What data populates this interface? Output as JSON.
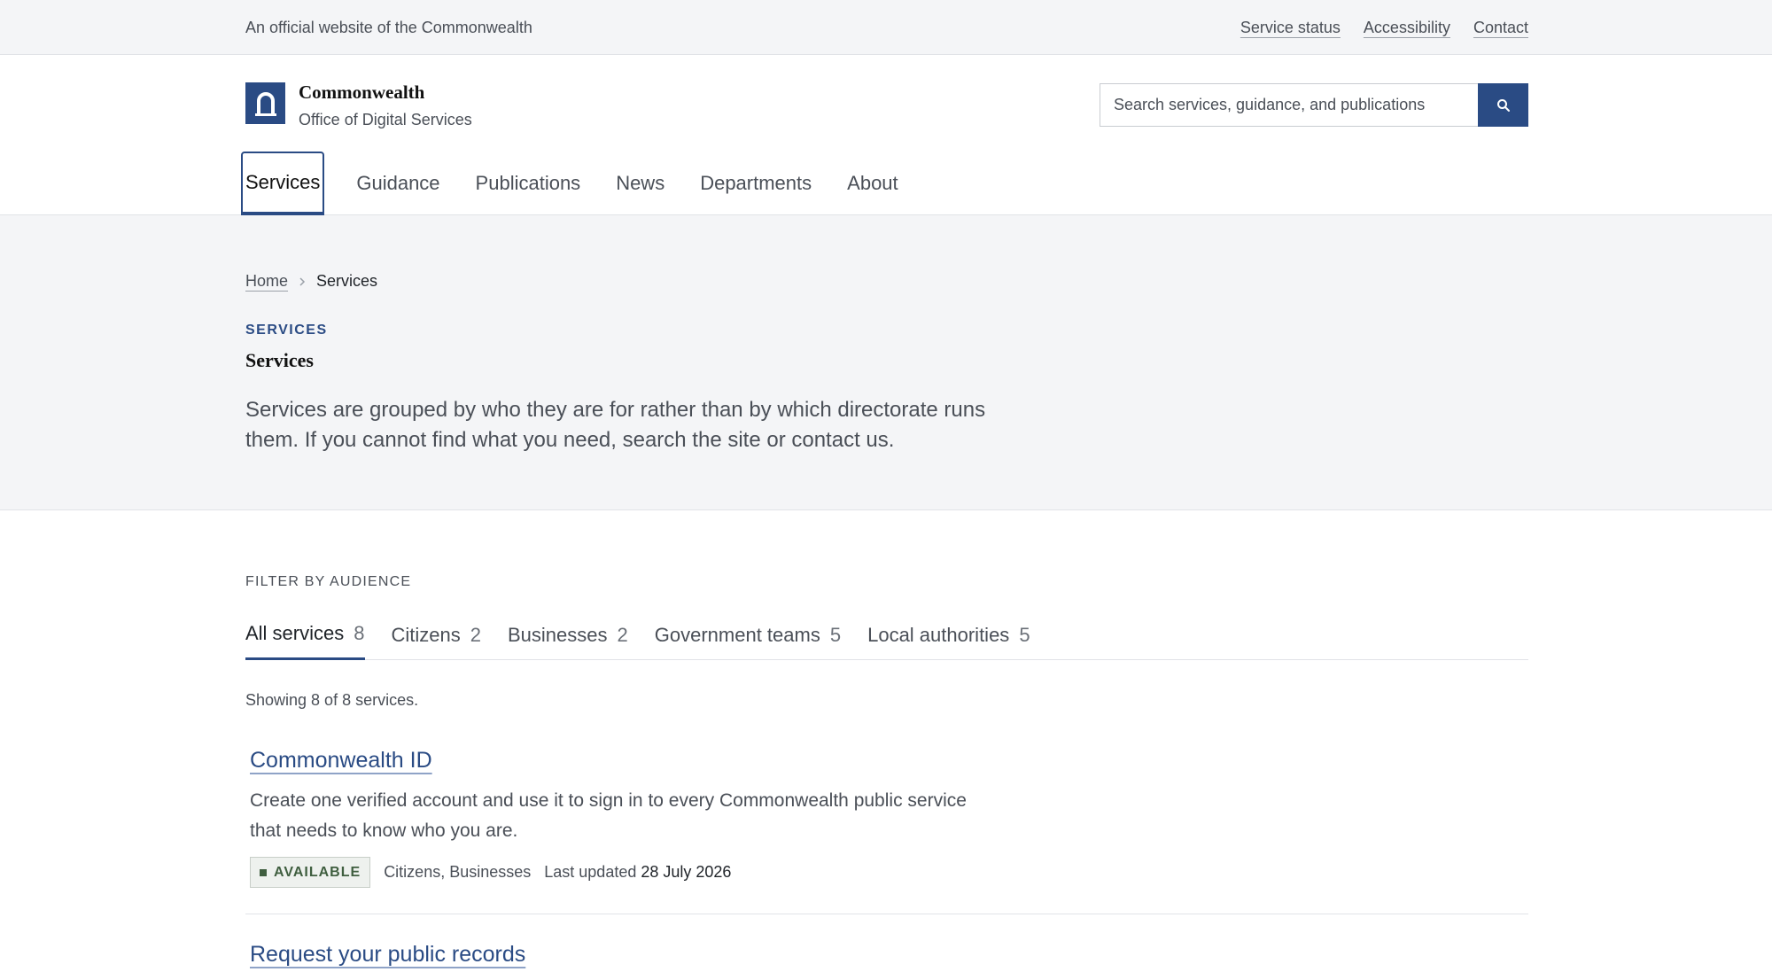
{
  "topbar": {
    "official_text": "An official website of the Commonwealth",
    "links": [
      "Service status",
      "Accessibility",
      "Contact"
    ]
  },
  "header": {
    "brand_name": "Commonwealth",
    "brand_sub": "Office of Digital Services",
    "search_placeholder": "Search services, guidance, and publications",
    "nav": [
      "Services",
      "Guidance",
      "Publications",
      "News",
      "Departments",
      "About"
    ],
    "active_nav": "Services"
  },
  "intro": {
    "breadcrumb_home": "Home",
    "breadcrumb_current": "Services",
    "eyebrow": "SERVICES",
    "title": "Services",
    "lede": "Services are grouped by who they are for rather than by which directorate runs them. If you cannot find what you need, search the site or contact us."
  },
  "filters": {
    "label": "FILTER BY AUDIENCE",
    "tabs": [
      {
        "label": "All services",
        "count": "8"
      },
      {
        "label": "Citizens",
        "count": "2"
      },
      {
        "label": "Businesses",
        "count": "2"
      },
      {
        "label": "Government teams",
        "count": "5"
      },
      {
        "label": "Local authorities",
        "count": "5"
      }
    ],
    "result_count": "Showing 8 of 8 services."
  },
  "services": [
    {
      "title": "Commonwealth ID",
      "description": "Create one verified account and use it to sign in to every Commonwealth public service that needs to know who you are.",
      "status": "AVAILABLE",
      "audience": "Citizens, Businesses",
      "updated_label": "Last updated",
      "updated_date": "28 July 2026"
    },
    {
      "title": "Request your public records"
    }
  ],
  "colors": {
    "brand": "#2a4b84",
    "band_bg": "#f4f5f7",
    "status_available": "#3f5e3f"
  }
}
